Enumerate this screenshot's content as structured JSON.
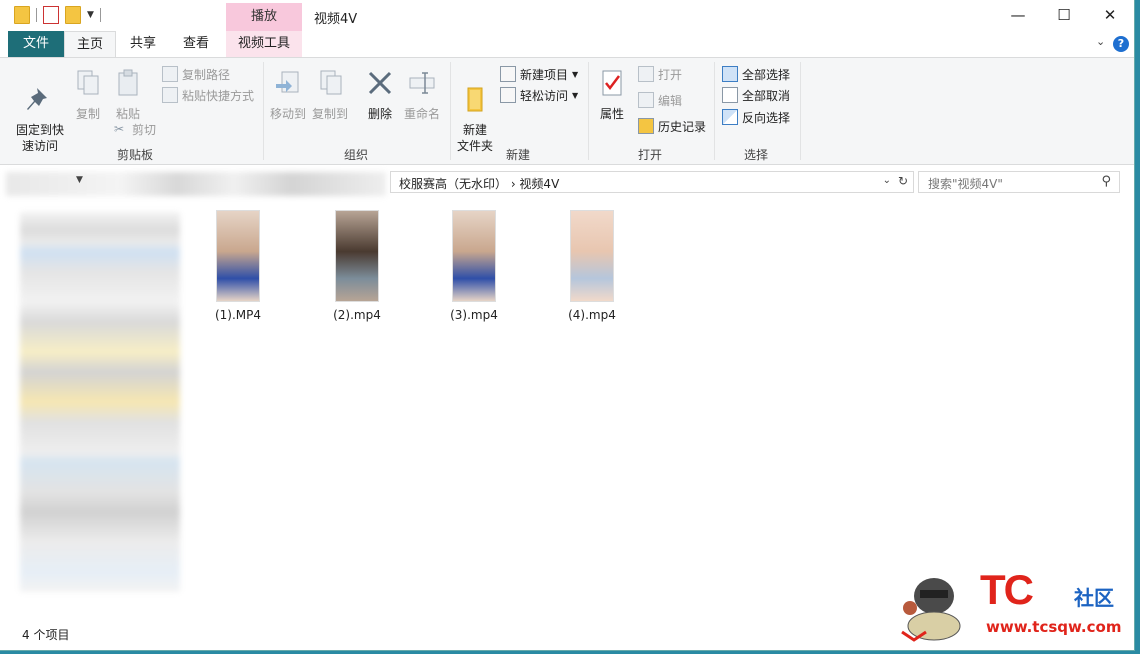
{
  "window": {
    "title": "视频4V",
    "context_tab_top": "播放",
    "minimize_glyph": "—",
    "maximize_glyph": "☐",
    "close_glyph": "✕"
  },
  "ribbon_tabs": [
    "文件",
    "主页",
    "共享",
    "查看",
    "视频工具"
  ],
  "ribbon": {
    "clipboard": {
      "pin_label": "固定到快\n速访问",
      "copy_label": "复制",
      "paste_label": "粘贴",
      "copy_path": "复制路径",
      "paste_shortcut": "粘贴快捷方式",
      "cut": "剪切",
      "group_label": "剪贴板"
    },
    "organize": {
      "move_to": "移动到",
      "copy_to": "复制到",
      "delete": "删除",
      "rename": "重命名",
      "group_label": "组织"
    },
    "new": {
      "new_folder": "新建\n文件夹",
      "new_item": "新建项目",
      "easy_access": "轻松访问",
      "group_label": "新建"
    },
    "open": {
      "properties": "属性",
      "open": "打开",
      "edit": "编辑",
      "history": "历史记录",
      "group_label": "打开"
    },
    "select": {
      "select_all": "全部选择",
      "select_none": "全部取消",
      "invert": "反向选择",
      "group_label": "选择"
    }
  },
  "address": {
    "crumbs": "校服赛高（无水印）  ›  视频4V",
    "search_placeholder": "搜索\"视频4V\""
  },
  "files": [
    {
      "name": "(1).MP4",
      "colors": [
        "#c9a78e",
        "#e6d4c6",
        "#2f4fa8"
      ]
    },
    {
      "name": "(2).mp4",
      "colors": [
        "#4a3a30",
        "#b7a495",
        "#7c8d9a"
      ]
    },
    {
      "name": "(3).mp4",
      "colors": [
        "#c9a78e",
        "#e6d4c6",
        "#2f4fa8"
      ]
    },
    {
      "name": "(4).mp4",
      "colors": [
        "#e8c6b0",
        "#f1d9ca",
        "#b5c6dc"
      ]
    }
  ],
  "status": {
    "item_count": "4 个项目"
  },
  "watermark": {
    "brand": "TC",
    "community": "社区",
    "url": "www.tcsqw.com"
  },
  "accent_colors": {
    "file_tab": "#1e6e78",
    "context_tab": "#f8c8dc",
    "watermark_red": "#e0241b",
    "watermark_blue": "#1c63c2"
  }
}
